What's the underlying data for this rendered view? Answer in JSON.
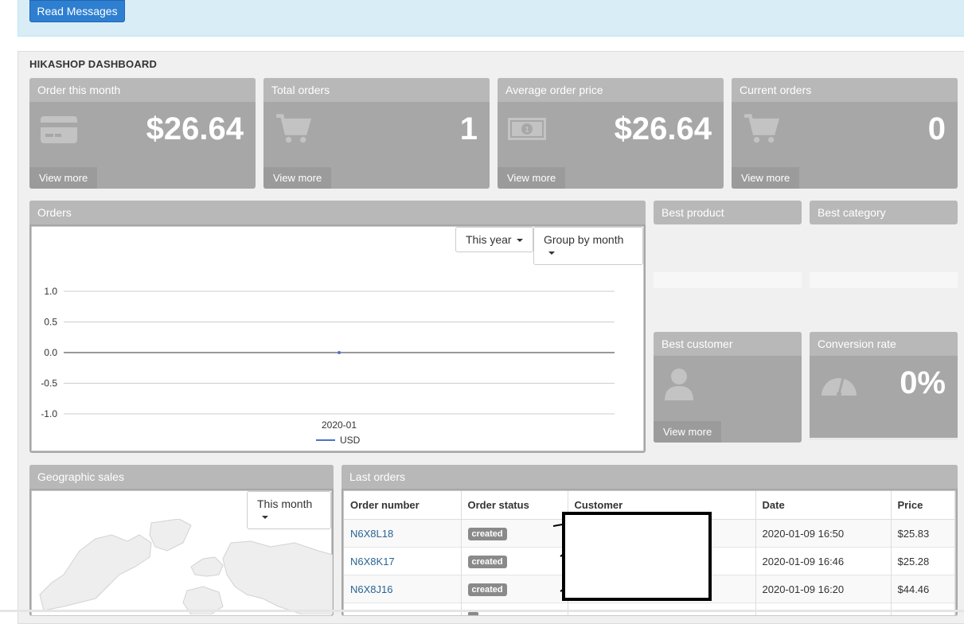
{
  "message_bar": {
    "button_label": "Read Messages"
  },
  "dashboard": {
    "title": "HIKASHOP DASHBOARD"
  },
  "stats": [
    {
      "title": "Order this month",
      "value": "$26.64",
      "icon": "credit-card-icon",
      "link": "View more"
    },
    {
      "title": "Total orders",
      "value": "1",
      "icon": "cart-icon",
      "link": "View more"
    },
    {
      "title": "Average order price",
      "value": "$26.64",
      "icon": "money-icon",
      "link": "View more"
    },
    {
      "title": "Current orders",
      "value": "0",
      "icon": "cart-icon",
      "link": "View more"
    }
  ],
  "orders_panel": {
    "title": "Orders",
    "period_select": "This year",
    "group_select": "Group by month"
  },
  "chart_data": {
    "type": "line",
    "x": [
      "2020-01"
    ],
    "series": [
      {
        "name": "USD",
        "values": [
          0.0
        ]
      }
    ],
    "yticks": [
      "1.0",
      "0.5",
      "0.0",
      "-0.5",
      "-1.0"
    ],
    "ylim": [
      -1.0,
      1.0
    ],
    "legend_label": "USD",
    "xtick_label": "2020-01",
    "color": "#4a74c9"
  },
  "best_product": {
    "title": "Best product"
  },
  "best_category": {
    "title": "Best category"
  },
  "best_customer": {
    "title": "Best customer",
    "link": "View more"
  },
  "conversion": {
    "title": "Conversion rate",
    "value": "0%"
  },
  "geo": {
    "title": "Geographic sales",
    "select": "This month"
  },
  "last_orders": {
    "title": "Last orders",
    "columns": [
      "Order number",
      "Order status",
      "Customer",
      "Date",
      "Price"
    ],
    "rows": [
      {
        "number": "N6X8L18",
        "status": "created",
        "date": "2020-01-09 16:50",
        "price": "$25.83"
      },
      {
        "number": "N6X8K17",
        "status": "created",
        "date": "2020-01-09 16:46",
        "price": "$25.28"
      },
      {
        "number": "N6X8J16",
        "status": "created",
        "date": "2020-01-09 16:20",
        "price": "$44.46"
      }
    ]
  }
}
